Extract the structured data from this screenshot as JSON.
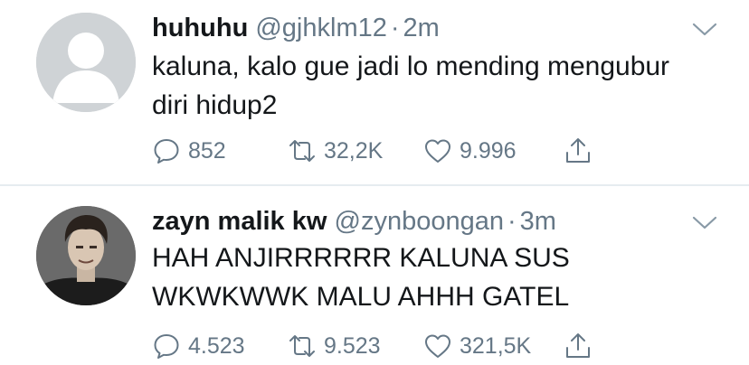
{
  "tweets": [
    {
      "name": "huhuhu",
      "handle": "@gjhklm12",
      "separator": "·",
      "time": "2m",
      "text": "kaluna, kalo gue jadi lo mending mengubur\ndiri hidup2",
      "replies": "852",
      "retweets": "32,2K",
      "likes": "9.996",
      "avatar": "default-avatar"
    },
    {
      "name": "zayn malik kw",
      "handle": "@zynboongan",
      "separator": "·",
      "time": "3m",
      "text": "HAH ANJIRRRRRR KALUNA SUS\nWKWKWWK MALU AHHH GATEL",
      "replies": "4.523",
      "retweets": "9.523",
      "likes": "321,5K",
      "avatar": "photo-avatar"
    }
  ],
  "icons": {
    "reply": "reply-icon",
    "retweet": "retweet-icon",
    "like": "heart-icon",
    "share": "share-icon",
    "menu": "chevron-down-icon"
  },
  "colors": {
    "secondary_text": "#657786",
    "primary_text": "#14171a",
    "divider": "#e6ecf0"
  }
}
